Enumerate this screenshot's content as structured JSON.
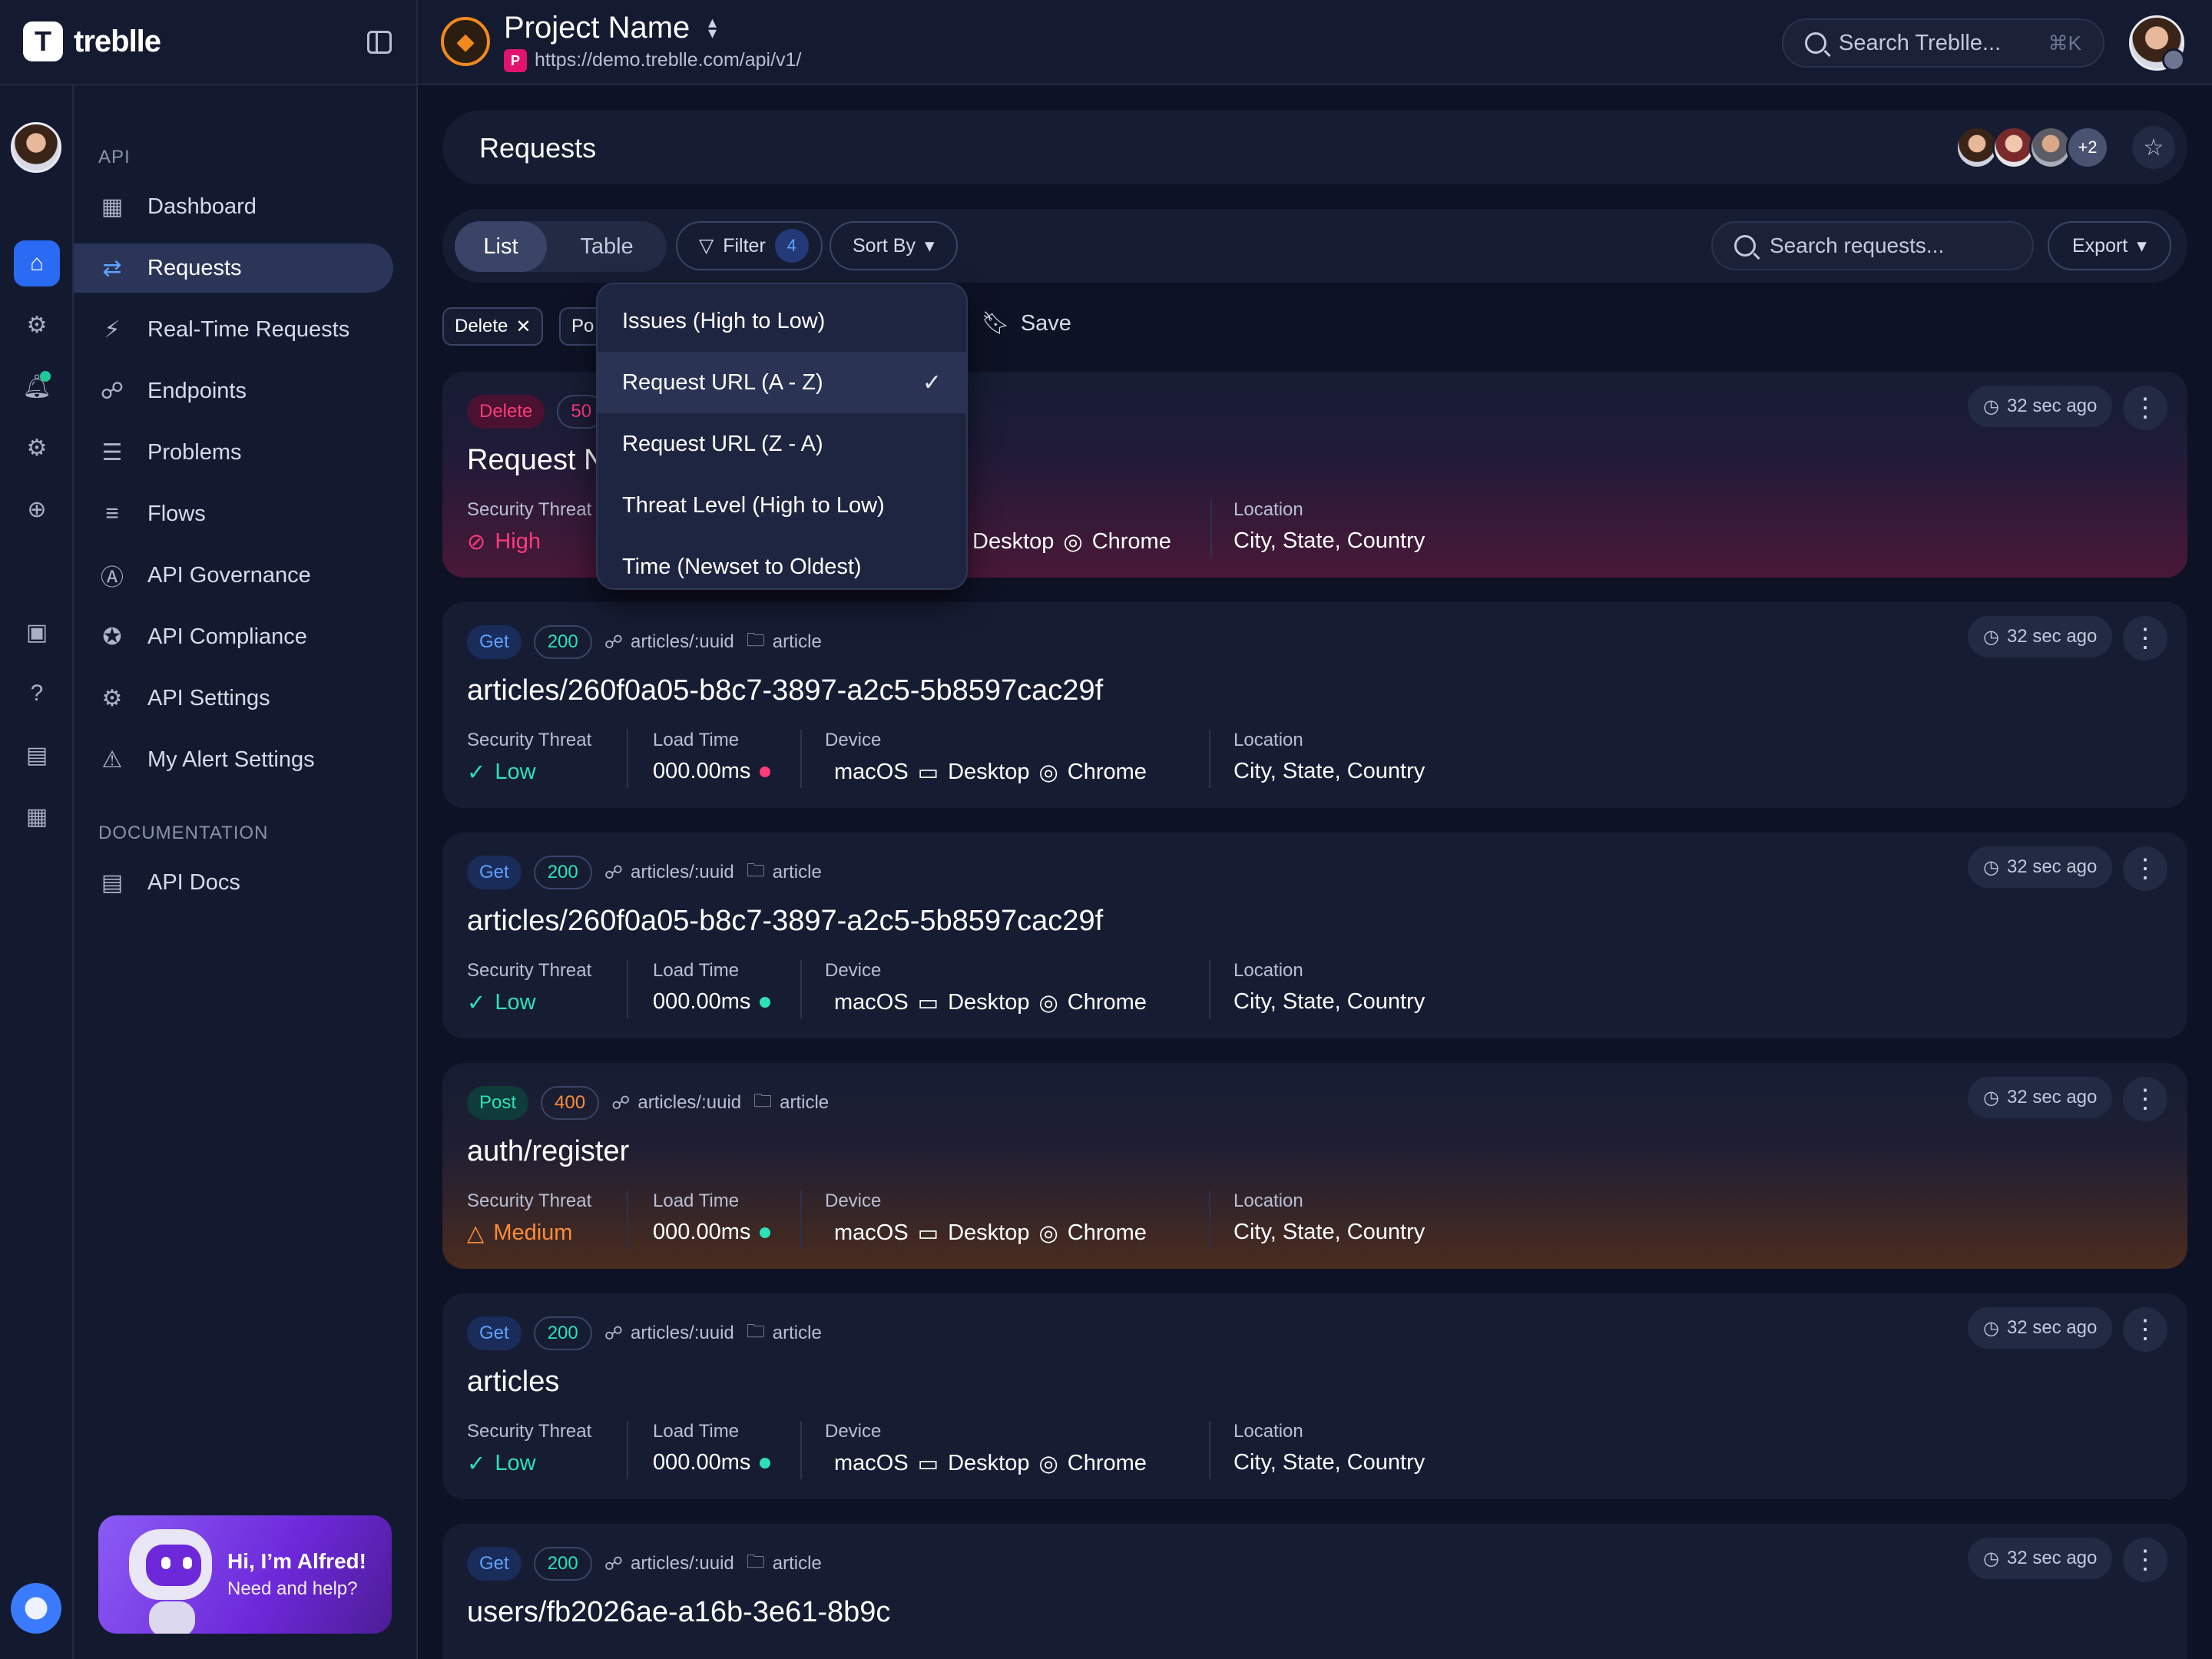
{
  "brand": {
    "name": "treblle",
    "icon_letter": "T"
  },
  "project": {
    "name": "Project Name",
    "badge": "P",
    "url": "https://demo.treblle.com/api/v1/"
  },
  "global_search": {
    "placeholder": "Search Treblle...",
    "shortcut": "⌘K"
  },
  "sidebar": {
    "api_section_title": "API",
    "items": [
      {
        "label": "Dashboard",
        "icon": "dashboard-icon"
      },
      {
        "label": "Requests",
        "icon": "requests-icon",
        "active": true
      },
      {
        "label": "Real-Time Requests",
        "icon": "realtime-icon"
      },
      {
        "label": "Endpoints",
        "icon": "endpoints-icon"
      },
      {
        "label": "Problems",
        "icon": "problems-icon"
      },
      {
        "label": "Flows",
        "icon": "flows-icon"
      },
      {
        "label": "API Governance",
        "icon": "governance-icon"
      },
      {
        "label": "API Compliance",
        "icon": "compliance-icon"
      },
      {
        "label": "API Settings",
        "icon": "settings-icon"
      },
      {
        "label": "My Alert Settings",
        "icon": "alert-icon"
      }
    ],
    "docs_section_title": "DOCUMENTATION",
    "docs_items": [
      {
        "label": "API Docs",
        "icon": "docs-icon"
      }
    ],
    "alfred": {
      "title": "Hi, I’m Alfred!",
      "subtitle": "Need and help?"
    }
  },
  "requests_header": {
    "title": "Requests",
    "collaborators_more": "+2"
  },
  "toolbar": {
    "view_tabs": [
      "List",
      "Table"
    ],
    "active_view": "List",
    "filter_label": "Filter",
    "filter_count": "4",
    "sort_label": "Sort By",
    "search_placeholder": "Search requests...",
    "export_label": "Export"
  },
  "active_filters": {
    "chips": [
      "Delete",
      "Po"
    ],
    "save_label": "Save"
  },
  "sort_menu": {
    "options": [
      "Issues (High to Low)",
      "Request URL (A - Z)",
      "Request URL (Z - A)",
      "Threat Level (High to Low)",
      "Time (Newset to Oldest)"
    ],
    "selected": "Request URL (A - Z)"
  },
  "field_labels": {
    "threat": "Security Threat",
    "load": "Load Time",
    "device": "Device",
    "location": "Location"
  },
  "requests": [
    {
      "method": "Delete",
      "status": "50",
      "title": "Request N",
      "threat": "High",
      "os": "",
      "device": "Desktop",
      "browser": "Chrome",
      "location": "City, State, Country",
      "time": "32 sec ago"
    },
    {
      "method": "Get",
      "status": "200",
      "endpoint": "articles/:uuid",
      "folder": "article",
      "title": "articles/260f0a05-b8c7-3897-a2c5-5b8597cac29f",
      "threat": "Low",
      "load_time": "000.00ms",
      "load_status": "red",
      "os": "macOS",
      "device": "Desktop",
      "browser": "Chrome",
      "location": "City, State, Country",
      "time": "32 sec ago"
    },
    {
      "method": "Get",
      "status": "200",
      "endpoint": "articles/:uuid",
      "folder": "article",
      "title": "articles/260f0a05-b8c7-3897-a2c5-5b8597cac29f",
      "threat": "Low",
      "load_time": "000.00ms",
      "load_status": "green",
      "os": "macOS",
      "device": "Desktop",
      "browser": "Chrome",
      "location": "City, State, Country",
      "time": "32 sec ago"
    },
    {
      "method": "Post",
      "status": "400",
      "endpoint": "articles/:uuid",
      "folder": "article",
      "title": "auth/register",
      "threat": "Medium",
      "load_time": "000.00ms",
      "load_status": "green",
      "os": "macOS",
      "device": "Desktop",
      "browser": "Chrome",
      "location": "City, State, Country",
      "time": "32 sec ago"
    },
    {
      "method": "Get",
      "status": "200",
      "endpoint": "articles/:uuid",
      "folder": "article",
      "title": "articles",
      "threat": "Low",
      "load_time": "000.00ms",
      "load_status": "green",
      "os": "macOS",
      "device": "Desktop",
      "browser": "Chrome",
      "location": "City, State, Country",
      "time": "32 sec ago"
    },
    {
      "method": "Get",
      "status": "200",
      "endpoint": "articles/:uuid",
      "folder": "article",
      "title": "users/fb2026ae-a16b-3e61-8b9c",
      "time": "32 sec ago"
    }
  ],
  "colors": {
    "accent": "#2b6bf3",
    "low": "#2ee0b5",
    "medium": "#ff8c3a",
    "high": "#ff3b7a",
    "background": "#0e1225"
  }
}
